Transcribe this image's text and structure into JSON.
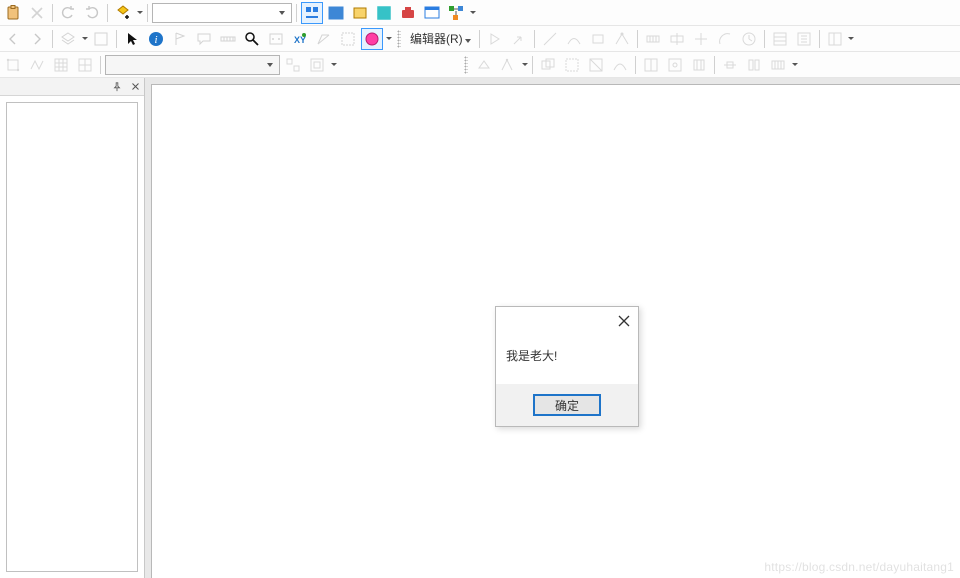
{
  "toolbars": {
    "row1": {
      "paste_icon": "paste",
      "close_icon": "close",
      "undo_icon": "undo",
      "redo_icon": "redo",
      "add_data_icon": "add-data",
      "scale_combo": {
        "value": ""
      },
      "identify_icon": "identify",
      "pan_icon": "pan",
      "zoom_icon": "zoom",
      "extent_icon": "extent",
      "window_icon": "window",
      "windows_icon": "windows",
      "tree_icon": "tree"
    },
    "row2": {
      "back_icon": "back",
      "fwd_icon": "forward",
      "layers_icon": "layers",
      "toc_icon": "toc",
      "arrow_icon": "arrow",
      "info_icon": "info",
      "flag_icon": "flag",
      "bubble_icon": "bubble",
      "ruler_icon": "ruler",
      "find_icon": "find",
      "box_icon": "box",
      "xy_icon": "XY",
      "sel_rect_icon": "sel-rect",
      "sel_poly_icon": "sel-poly",
      "sel_circle_icon": "sel-circle",
      "editor_label": "编辑器(R)",
      "line_icons": [
        "play",
        "edit-arrow",
        "line",
        "curve",
        "rect",
        "vertex",
        "cut",
        "extend",
        "rotate",
        "clock"
      ],
      "page_icons": [
        "attr1",
        "attr2"
      ],
      "props_icon": "properties"
    },
    "row3": {
      "icons": [
        "snap1",
        "snap2",
        "grid1",
        "grid2"
      ],
      "layer_combo": {
        "value": ""
      },
      "post_icons": [
        "task1",
        "task2"
      ],
      "topo_icons": [
        "t1",
        "t2",
        "t3",
        "t4",
        "t5",
        "t6",
        "t7",
        "t8",
        "t9",
        "t10",
        "t11",
        "t12"
      ]
    }
  },
  "panel": {
    "pin_name": "pin",
    "close_name": "close"
  },
  "dialog": {
    "message": "我是老大!",
    "ok_label": "确定"
  },
  "watermark": "https://blog.csdn.net/dayuhaitang1"
}
